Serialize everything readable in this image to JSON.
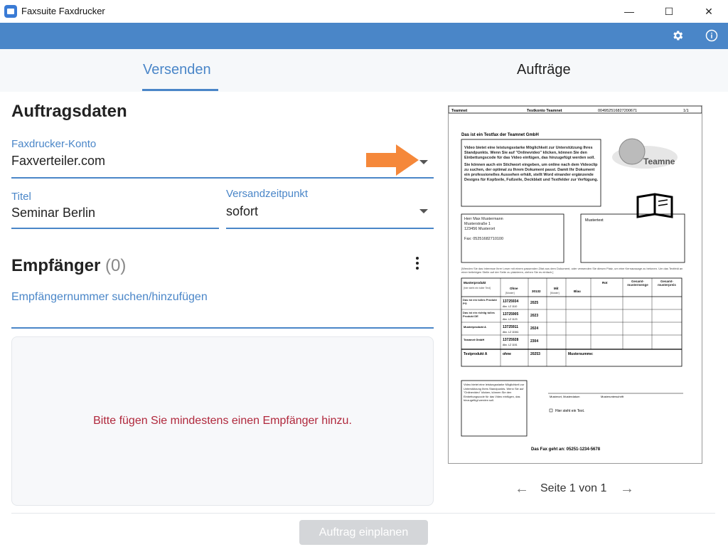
{
  "window": {
    "title": "Faxsuite Faxdrucker",
    "minimize": "—",
    "maximize": "☐",
    "close": "✕"
  },
  "toolbar": {
    "settings_icon": "gear-icon",
    "info_icon": "info-icon"
  },
  "tabs": [
    {
      "label": "Versenden",
      "active": true
    },
    {
      "label": "Aufträge",
      "active": false
    }
  ],
  "form": {
    "heading": "Auftragsdaten",
    "account": {
      "label": "Faxdrucker-Konto",
      "value": "Faxverteiler.com"
    },
    "title": {
      "label": "Titel",
      "value": "Seminar Berlin"
    },
    "send_time": {
      "label": "Versandzeitpunkt",
      "value": "sofort"
    }
  },
  "recipients": {
    "heading": "Empfänger",
    "count": "(0)",
    "search_placeholder": "Empfängernummer suchen/hinzufügen",
    "empty_message": "Bitte fügen Sie mindestens einen Empfänger hinzu."
  },
  "preview": {
    "header_left": "Teamnet",
    "header_mid": "Testkonto Teamnet",
    "header_fax": "004952516827200671",
    "header_page": "1/1",
    "title": "Das ist ein Testfax der Teamnet GmbH",
    "info_text_1": "Video bietet eine leistungsstarke Möglichkeit zur Unterstützung Ihres Standpunkts. Wenn Sie auf \"Onlinevideo\" klicken, können Sie den Einbettungscode für das Video einfügen, das hinzugefügt werden soll.",
    "info_text_2": "Sie können auch ein Stichwort eingeben, um online nach dem Videoclip zu suchen, der optimal zu Ihrem Dokument passt. Damit Ihr Dokument ein professionelles Aussehen erhält, stellt Word einander ergänzende Designs für Kopfzeile, Fußzeile, Deckblatt und Textfelder zur Verfügung.",
    "logo_text": "Teamne",
    "address": [
      "Herr Max Mustermann",
      "Musterstraße 1",
      "123456 Musterort",
      "",
      "Fax: 05251682710100"
    ],
    "mustertext": "Mustertext",
    "note": "[Wenden Sie das Interesse Ihrer Leser mit einem passenden Zitat aus dem Dokument, oder verwenden Sie diesen Platz, um eine Kernaussage zu betonen. Um das Textfeld an einer beliebigen Stelle auf der Seite zu platzieren, ziehen Sie es einfach.]",
    "table_headers": [
      "Musterprodukt",
      "Ohne",
      "30132",
      "Mit",
      "Blau",
      "Rot",
      "Gesamt-mustermenge",
      "Gesamt-musterpreis"
    ],
    "table_subheaders": [
      "[hier steht ein toller Text]",
      "[Muster]",
      "",
      "[Muster]"
    ],
    "table_rows": [
      [
        "Das ist ein tolles Produkt PG",
        "13725934",
        "Abc. LZ 1110",
        "2025"
      ],
      [
        "Das ist ein richtig tolles Produkt DE",
        "13725905",
        "Abc. LZ 1123",
        "2023"
      ],
      [
        "Musterprodukt A",
        "13725911",
        "Abc. LZ 11541",
        "2024"
      ],
      [
        "Teamnet GmbH",
        "13725928",
        "Abc. LZ 1151",
        "2304"
      ]
    ],
    "table_total": [
      "Testprodukt A",
      "ohne",
      "20253",
      "Mustersumme:"
    ],
    "bottom_box": "Video bietet eine leistungsstarke Möglichkeit zur Unterstützung Ihres Standpunkts. Wenn Sie auf \"Onlinevideo\" klicken, können Sie den Einbettungscode für das Video einfügen, das hinzugefügt werden soll.",
    "signature_left": "Musterort, Musterdatum",
    "signature_right": "Musterunterschrift",
    "checkbox_text": "Hier steht ein Text.",
    "footer": "Das Fax geht an: 05251-1234-5678"
  },
  "pager": {
    "prev": "←",
    "text": "Seite 1 von 1",
    "next": "→"
  },
  "submit": {
    "label": "Auftrag einplanen"
  },
  "colors": {
    "accent": "#4a86c8",
    "error": "#b0283c",
    "annotation": "#f5883a"
  }
}
